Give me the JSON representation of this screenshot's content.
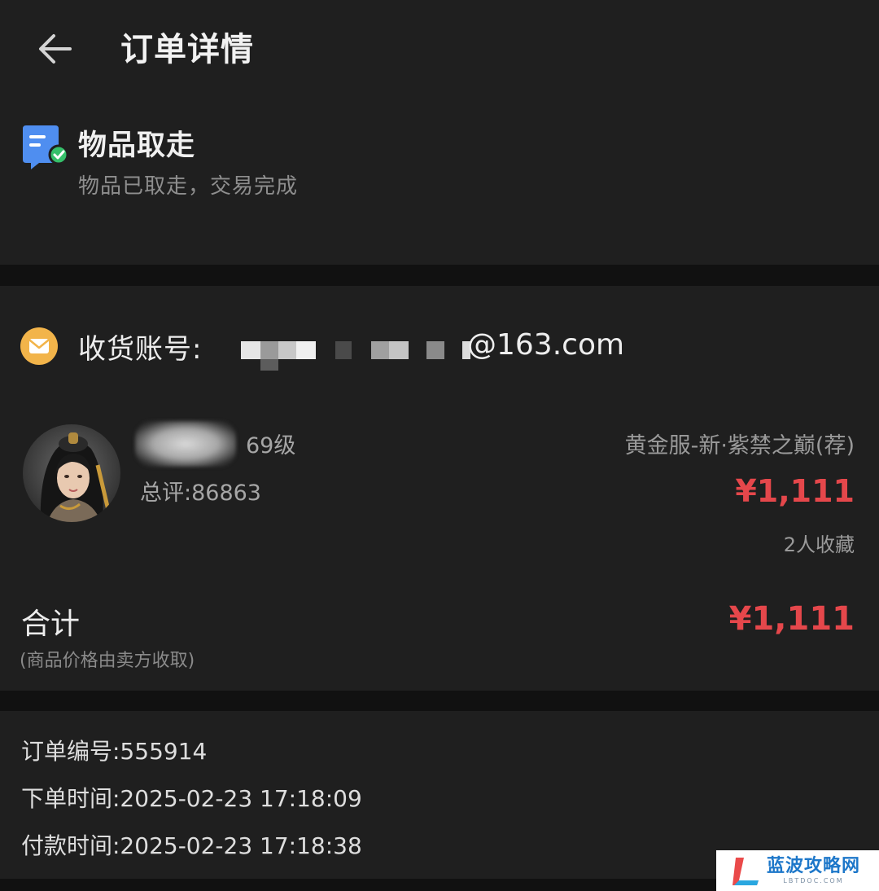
{
  "header": {
    "title": "订单详情",
    "back_icon": "arrow-left-icon"
  },
  "status": {
    "title": "物品取走",
    "description": "物品已取走，交易完成",
    "icon": "document-check-icon"
  },
  "order": {
    "account_label": "收货账号:",
    "account_visible_suffix": "@163.com",
    "role": {
      "level": "69级",
      "score": "总评:86863"
    },
    "server": "黄金服-新·紫禁之巅(荐)",
    "price": "¥1,111",
    "favorites": "2人收藏",
    "total_label": "合计",
    "total_price": "¥1,111",
    "total_note": "(商品价格由卖方收取)"
  },
  "info": {
    "order_number": "订单编号:555914",
    "order_time": "下单时间:2025-02-23 17:18:09",
    "pay_time": "付款时间:2025-02-23 17:18:38"
  },
  "watermark": {
    "name": "蓝波攻略网",
    "domain": "LBTDOC.COM"
  },
  "colors": {
    "background": "#1f1f1f",
    "divider": "#111111",
    "price": "#e5474b",
    "status_icon_blue": "#4f8ef0",
    "status_icon_green": "#35c06a",
    "mail_icon": "#f2b44a"
  }
}
